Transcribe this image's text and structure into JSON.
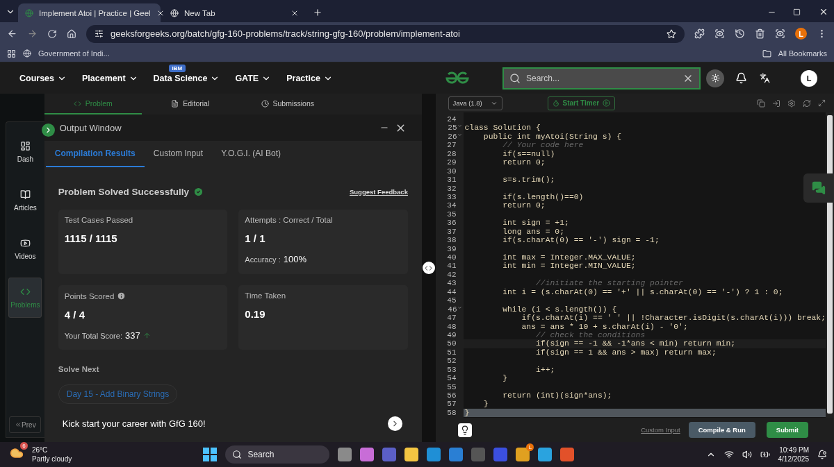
{
  "browser": {
    "tabs": [
      {
        "title": "Implement Atoi | Practice | Geel",
        "selected": true
      },
      {
        "title": "New Tab",
        "selected": false
      }
    ],
    "url": "geeksforgeeks.org/batch/gfg-160-problems/track/string-gfg-160/problem/implement-atoi",
    "bookmark": "Government of Indi...",
    "all_bookmarks": "All Bookmarks",
    "profile": "L"
  },
  "site_nav": {
    "items": [
      {
        "label": "Courses"
      },
      {
        "label": "Placement"
      },
      {
        "label": "Data Science",
        "badge": "IBM"
      },
      {
        "label": "GATE"
      },
      {
        "label": "Practice"
      }
    ],
    "search_placeholder": "Search...",
    "avatar": "L"
  },
  "sidebar": {
    "items": [
      {
        "label": "Dash",
        "selected": false
      },
      {
        "label": "Articles",
        "selected": false
      },
      {
        "label": "Videos",
        "selected": false
      },
      {
        "label": "Problems",
        "selected": true
      }
    ],
    "prev": "Prev"
  },
  "problem_tabs": [
    {
      "label": "Problem",
      "selected": true
    },
    {
      "label": "Editorial",
      "selected": false
    },
    {
      "label": "Submissions",
      "selected": false
    }
  ],
  "output_window": {
    "title": "Output Window",
    "tabs": [
      {
        "label": "Compilation Results",
        "selected": true
      },
      {
        "label": "Custom Input",
        "selected": false
      },
      {
        "label": "Y.O.G.I. (AI Bot)",
        "selected": false
      }
    ],
    "status": "Problem Solved Successfully",
    "feedback": "Suggest Feedback",
    "cards": [
      {
        "label": "Test Cases Passed",
        "value": "1115 / 1115",
        "info": false
      },
      {
        "label": "Attempts : Correct / Total",
        "value": "1 / 1",
        "extra_label": "Accuracy :",
        "extra_value": "100%",
        "info": false
      },
      {
        "label": "Points Scored",
        "value": "4 / 4",
        "extra_label": "Your Total Score:",
        "extra_value": "337",
        "rising": true,
        "info": true
      },
      {
        "label": "Time Taken",
        "value": "0.19",
        "info": false
      }
    ],
    "solve_next": "Solve Next",
    "next_problem": "Day 15 - Add Binary Strings",
    "promo": "Kick start your career with GfG 160!"
  },
  "editor": {
    "language": "Java (1.8)",
    "timer": "Start Timer",
    "custom_input": "Custom Input",
    "compile": "Compile & Run",
    "submit": "Submit",
    "lines": [
      {
        "n": "24",
        "kind": "code"
      },
      {
        "n": "25",
        "code": "class Solution {",
        "kind": "code",
        "fold": true
      },
      {
        "n": "26",
        "code": "    public int myAtoi(String s) {",
        "kind": "code",
        "fold": true
      },
      {
        "n": "27",
        "code": "        // Your code here",
        "kind": "comment"
      },
      {
        "n": "28",
        "code": "        if(s==null)",
        "kind": "code"
      },
      {
        "n": "29",
        "code": "        return 0;",
        "kind": "code"
      },
      {
        "n": "30",
        "kind": "code"
      },
      {
        "n": "31",
        "code": "        s=s.trim();",
        "kind": "code"
      },
      {
        "n": "32",
        "kind": "code"
      },
      {
        "n": "33",
        "code": "        if(s.length()==0)",
        "kind": "code"
      },
      {
        "n": "34",
        "code": "        return 0;",
        "kind": "code"
      },
      {
        "n": "35",
        "kind": "code"
      },
      {
        "n": "36",
        "code": "        int sign = +1;",
        "kind": "code"
      },
      {
        "n": "37",
        "code": "        long ans = 0;",
        "kind": "code"
      },
      {
        "n": "38",
        "code": "        if(s.charAt(0) == '-') sign = -1;",
        "kind": "code"
      },
      {
        "n": "39",
        "kind": "code"
      },
      {
        "n": "40",
        "code": "        int max = Integer.MAX_VALUE;",
        "kind": "code"
      },
      {
        "n": "41",
        "code": "        int min = Integer.MIN_VALUE;",
        "kind": "code"
      },
      {
        "n": "42",
        "kind": "code"
      },
      {
        "n": "43",
        "code": "               //initiate the starting pointer",
        "kind": "comment"
      },
      {
        "n": "44",
        "code": "        int i = (s.charAt(0) == '+' || s.charAt(0) == '-') ? 1 : 0;",
        "kind": "code"
      },
      {
        "n": "45",
        "kind": "code"
      },
      {
        "n": "46",
        "code": "        while (i < s.length()) {",
        "kind": "code",
        "fold": true
      },
      {
        "n": "47",
        "code": "            if(s.charAt(i) == ' ' || !Character.isDigit(s.charAt(i))) break;",
        "kind": "code"
      },
      {
        "n": "48",
        "code": "            ans = ans * 10 + s.charAt(i) - '0';",
        "kind": "code"
      },
      {
        "n": "49",
        "code": "               // check the conditions",
        "kind": "comment"
      },
      {
        "n": "50",
        "code": "               if(sign == -1 && -1*ans < min) return min;",
        "kind": "code",
        "active": true
      },
      {
        "n": "51",
        "code": "               if(sign == 1 && ans > max) return max;",
        "kind": "code"
      },
      {
        "n": "52",
        "kind": "code"
      },
      {
        "n": "53",
        "code": "               i++;",
        "kind": "code"
      },
      {
        "n": "54",
        "code": "        }",
        "kind": "code"
      },
      {
        "n": "55",
        "kind": "code"
      },
      {
        "n": "56",
        "code": "        return (int)(sign*ans);",
        "kind": "code"
      },
      {
        "n": "57",
        "code": "    }",
        "kind": "code"
      },
      {
        "n": "58",
        "code": "}",
        "kind": "code",
        "selected": true
      }
    ]
  },
  "taskbar": {
    "temp": "26°C",
    "weather": "Partly cloudy",
    "weather_badge": "6",
    "search": "Search",
    "time": "10:49 PM",
    "date": "4/12/2025",
    "chrome_badge": "L"
  }
}
